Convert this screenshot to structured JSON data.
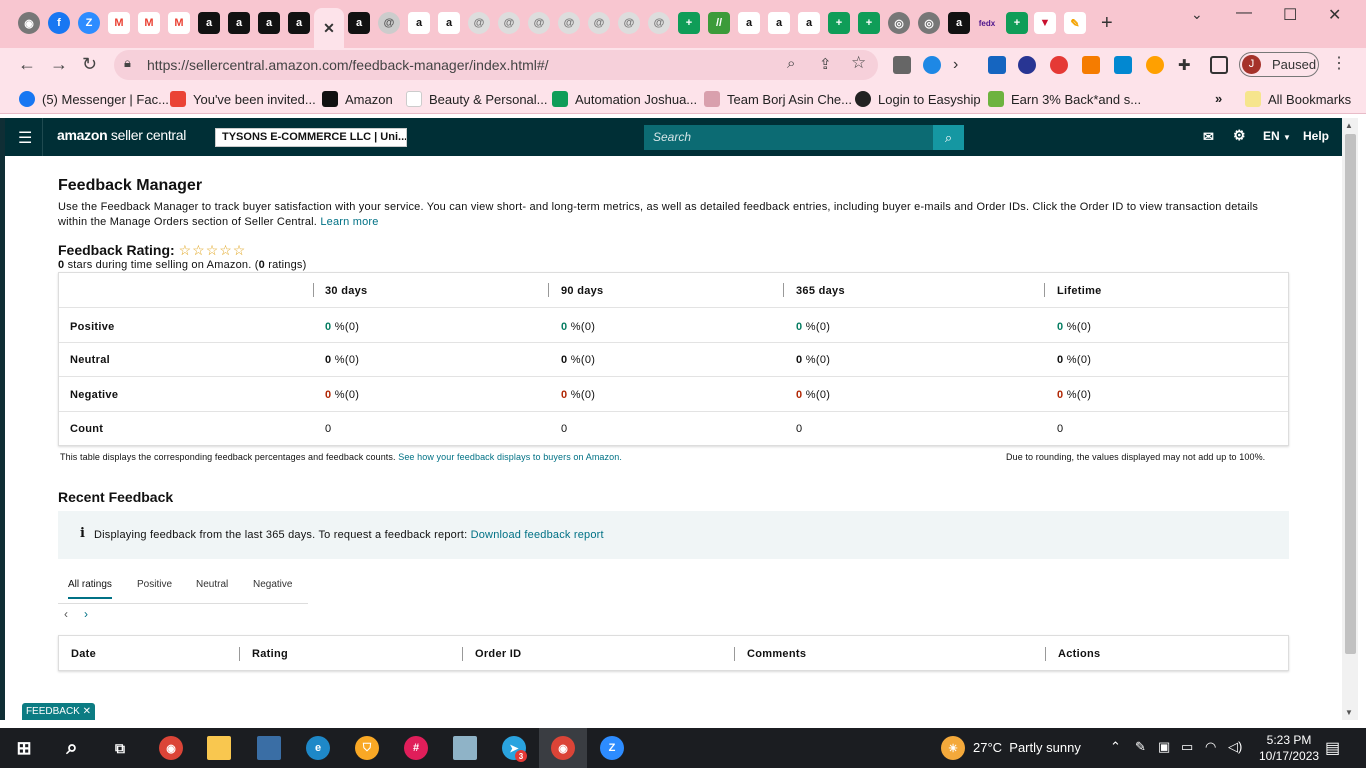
{
  "browser": {
    "url": "https://sellercentral.amazon.com/feedback-manager/index.html#/",
    "profile_initial": "J",
    "profile_status": "Paused",
    "bookmarks": [
      {
        "label": "(5) Messenger | Fac...",
        "color": "#1877f2"
      },
      {
        "label": "You've been invited...",
        "color": "#ea4335"
      },
      {
        "label": "Amazon",
        "color": "#111111"
      },
      {
        "label": "Beauty & Personal...",
        "color": "#ffffff"
      },
      {
        "label": "Automation Joshua...",
        "color": "#0f9d58"
      },
      {
        "label": "Team Borj Asin Che...",
        "color": "#f8c6d0"
      },
      {
        "label": "Login to Easyship",
        "color": "#222222"
      },
      {
        "label": "Earn 3% Back*and s...",
        "color": "#6db33f"
      }
    ],
    "all_bookmarks": "All Bookmarks"
  },
  "seller_header": {
    "logo_main": "amazon",
    "logo_sub": "seller central",
    "account": "TYSONS E-COMMERCE LLC | Uni...",
    "search_placeholder": "Search",
    "language": "EN",
    "help": "Help"
  },
  "page": {
    "title": "Feedback Manager",
    "description": "Use the Feedback Manager to track buyer satisfaction with your service. You can view short- and long-term metrics, as well as detailed feedback entries, including buyer e-mails and Order IDs. Click the Order ID to view transaction details within the Manage Orders section of Seller Central.",
    "learn_more": "Learn more",
    "rating_label": "Feedback Rating:",
    "stars_count": "0",
    "stars_text": "stars during time selling on Amazon. (",
    "ratings_count": "0",
    "ratings_text": "ratings)"
  },
  "feedback_table": {
    "columns": [
      "30 days",
      "90 days",
      "365 days",
      "Lifetime"
    ],
    "rows": [
      {
        "label": "Positive",
        "cells": [
          {
            "value": "0",
            "suffix": "%(0)"
          },
          {
            "value": "0",
            "suffix": "%(0)"
          },
          {
            "value": "0",
            "suffix": "%(0)"
          },
          {
            "value": "0",
            "suffix": "%(0)"
          }
        ]
      },
      {
        "label": "Neutral",
        "cells": [
          {
            "value": "0",
            "suffix": "%(0)"
          },
          {
            "value": "0",
            "suffix": "%(0)"
          },
          {
            "value": "0",
            "suffix": "%(0)"
          },
          {
            "value": "0",
            "suffix": "%(0)"
          }
        ]
      },
      {
        "label": "Negative",
        "cells": [
          {
            "value": "0",
            "suffix": "%(0)"
          },
          {
            "value": "0",
            "suffix": "%(0)"
          },
          {
            "value": "0",
            "suffix": "%(0)"
          },
          {
            "value": "0",
            "suffix": "%(0)"
          }
        ]
      },
      {
        "label": "Count",
        "cells": [
          {
            "value": "0",
            "suffix": ""
          },
          {
            "value": "0",
            "suffix": ""
          },
          {
            "value": "0",
            "suffix": ""
          },
          {
            "value": "0",
            "suffix": ""
          }
        ]
      }
    ],
    "footnote": "This table displays the corresponding feedback percentages and feedback counts.",
    "footnote_link": "See how your feedback displays to buyers on Amazon.",
    "rounding_note": "Due to rounding, the values displayed may not add up to 100%."
  },
  "recent": {
    "title": "Recent Feedback",
    "info_text": "Displaying feedback from the last 365 days. To request a feedback report:",
    "download_link": "Download feedback report",
    "tabs": [
      "All ratings",
      "Positive",
      "Neutral",
      "Negative"
    ],
    "columns": [
      "Date",
      "Rating",
      "Order ID",
      "Comments",
      "Actions"
    ]
  },
  "feedback_tag": "FEEDBACK",
  "taskbar": {
    "weather_temp": "27°C",
    "weather_desc": "Partly sunny",
    "time": "5:23 PM",
    "date": "10/17/2023",
    "telegram_badge": "3"
  },
  "colors": {
    "seller_header": "#002f36",
    "search_bg": "#0c6b73",
    "positive": "#067d62",
    "negative": "#b12704",
    "link": "#007185"
  }
}
